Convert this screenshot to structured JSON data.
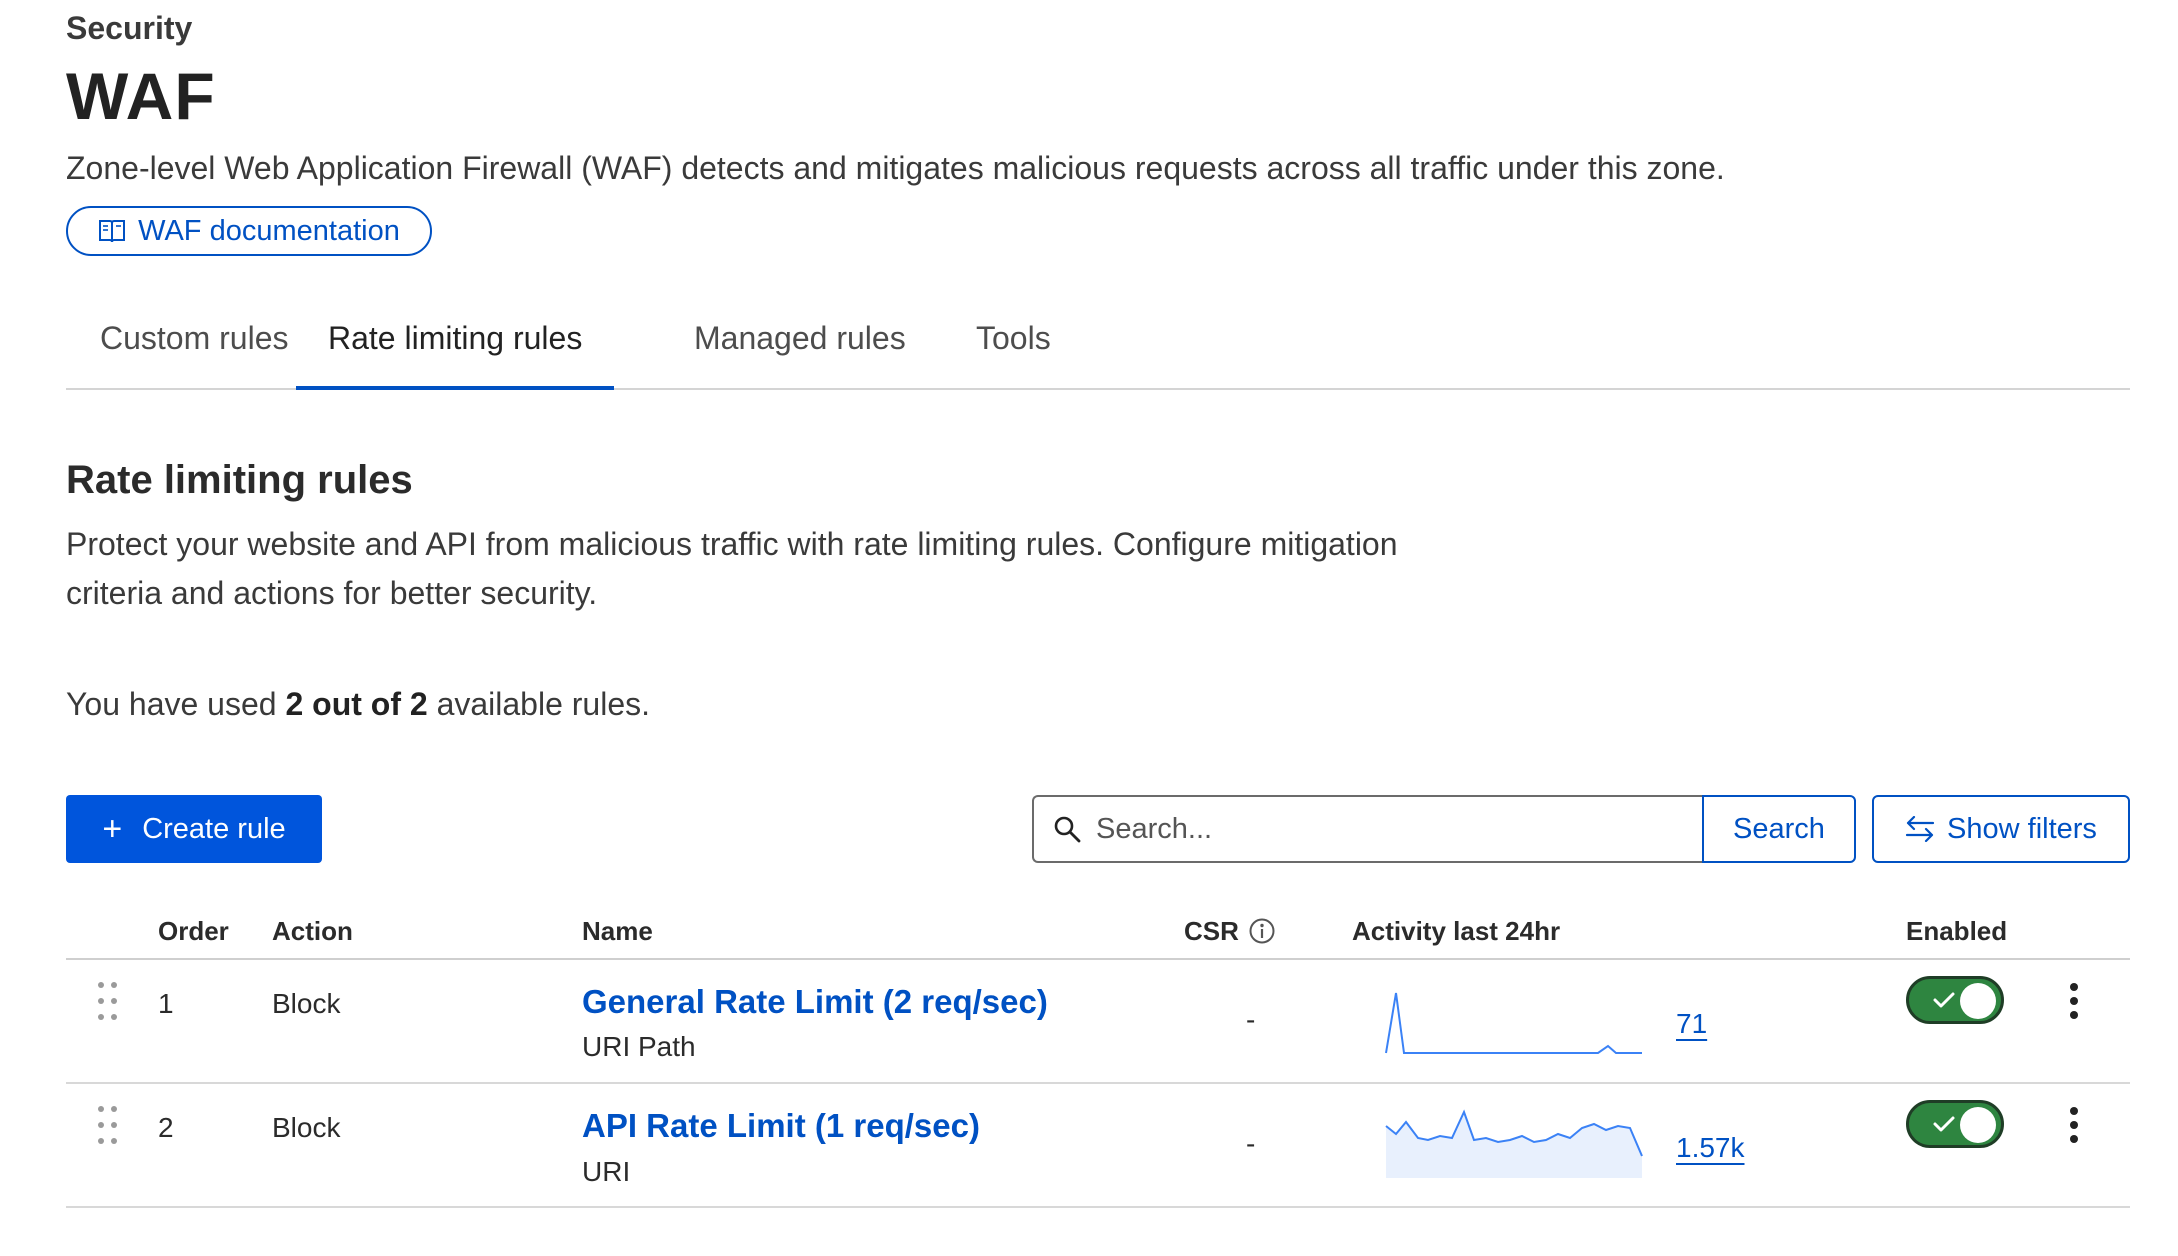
{
  "header": {
    "breadcrumb": "Security",
    "title": "WAF",
    "description": "Zone-level Web Application Firewall (WAF) detects and mitigates malicious requests across all traffic under this zone.",
    "doc_link": "WAF documentation"
  },
  "tabs": [
    {
      "label": "Custom rules",
      "active": false
    },
    {
      "label": "Rate limiting rules",
      "active": true
    },
    {
      "label": "Managed rules",
      "active": false
    },
    {
      "label": "Tools",
      "active": false
    }
  ],
  "section": {
    "title": "Rate limiting rules",
    "description": "Protect your website and API from malicious traffic with rate limiting rules. Configure mitigation criteria and actions for better security.",
    "usage_prefix": "You have used ",
    "usage_bold": "2 out of 2",
    "usage_suffix": " available rules."
  },
  "toolbar": {
    "create_label": "Create rule",
    "search_placeholder": "Search...",
    "search_label": "Search",
    "filters_label": "Show filters"
  },
  "table": {
    "columns": {
      "order": "Order",
      "action": "Action",
      "name": "Name",
      "csr": "CSR",
      "activity": "Activity last 24hr",
      "enabled": "Enabled"
    },
    "rows": [
      {
        "order": "1",
        "action": "Block",
        "name": "General Rate Limit (2 req/sec)",
        "sub": "URI Path",
        "csr": "-",
        "count": "71",
        "enabled": true
      },
      {
        "order": "2",
        "action": "Block",
        "name": "API Rate Limit (1 req/sec)",
        "sub": "URI",
        "csr": "-",
        "count": "1.57k",
        "enabled": true
      }
    ]
  },
  "colors": {
    "accent": "#0051c3",
    "primary_button": "#0055dc",
    "toggle_on": "#2e8540",
    "sparkline": "#3b82f6"
  },
  "icons": {
    "doc": "book-icon",
    "create": "plus-icon",
    "search": "magnifier-icon",
    "filters": "arrows-swap-icon",
    "csr_info": "info-icon",
    "drag": "drag-handle-icon",
    "menu": "kebab-icon",
    "toggle": "check-icon"
  }
}
